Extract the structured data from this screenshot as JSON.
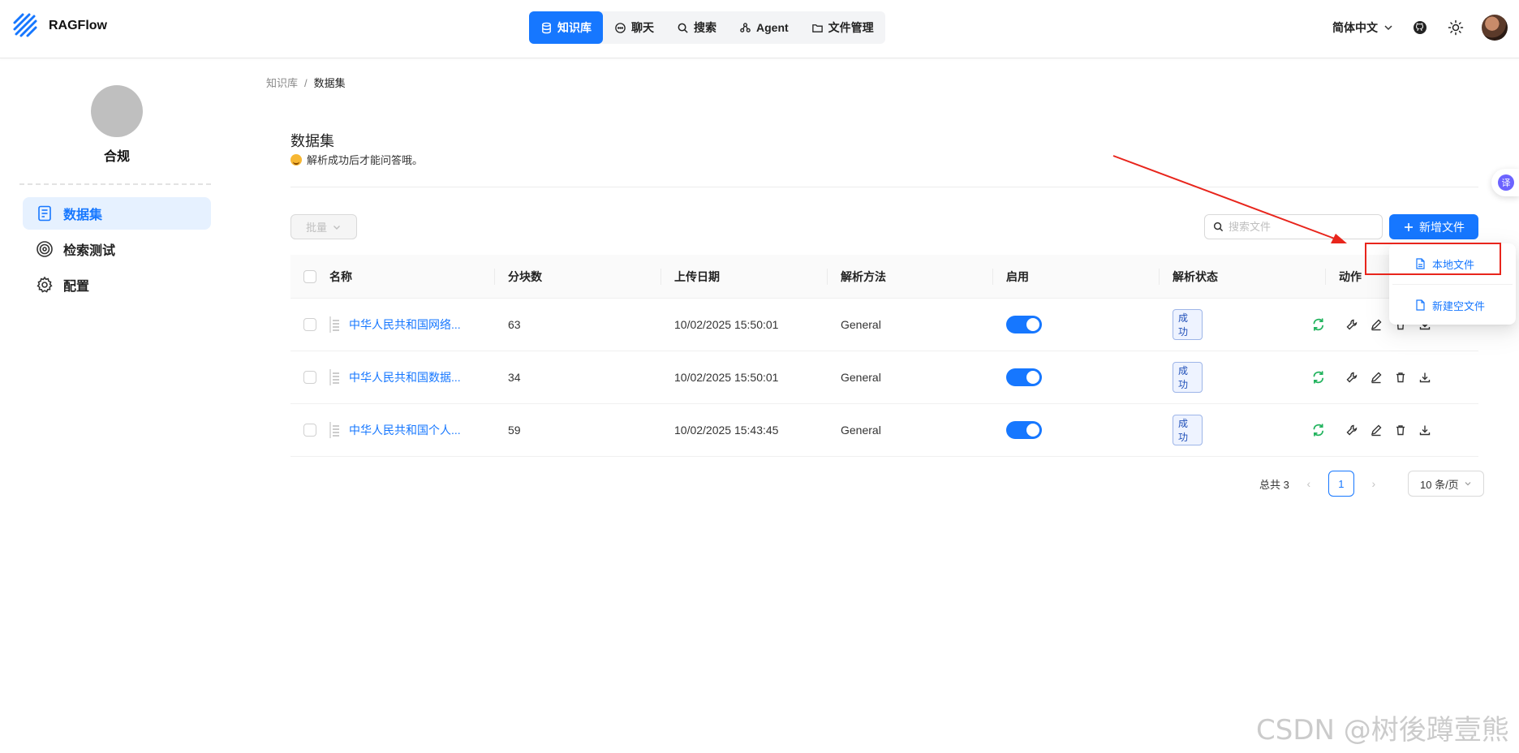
{
  "brand": {
    "name": "RAGFlow"
  },
  "nav": [
    {
      "label": "知识库",
      "icon": "database-icon"
    },
    {
      "label": "聊天",
      "icon": "chat-icon"
    },
    {
      "label": "搜索",
      "icon": "search-icon"
    },
    {
      "label": "Agent",
      "icon": "agent-icon"
    },
    {
      "label": "文件管理",
      "icon": "folder-icon"
    }
  ],
  "header": {
    "language": "简体中文"
  },
  "sidebar": {
    "kb_name": "合规",
    "items": [
      {
        "label": "数据集",
        "icon": "document-icon",
        "active": true
      },
      {
        "label": "检索测试",
        "icon": "target-icon"
      },
      {
        "label": "配置",
        "icon": "gear-icon"
      }
    ]
  },
  "breadcrumb": {
    "root": "知识库",
    "separator": "/",
    "current": "数据集"
  },
  "page": {
    "title": "数据集",
    "subtitle": "解析成功后才能问答哦。"
  },
  "toolbar": {
    "batch_label": "批量",
    "search_placeholder": "搜索文件",
    "add_label": "新增文件"
  },
  "table": {
    "columns": [
      "名称",
      "分块数",
      "上传日期",
      "解析方法",
      "启用",
      "解析状态",
      "动作"
    ],
    "rows": [
      {
        "name": "中华人民共和国网络...",
        "chunks": "63",
        "date": "10/02/2025 15:50:01",
        "method": "General",
        "enabled": true,
        "status": "成功"
      },
      {
        "name": "中华人民共和国数据...",
        "chunks": "34",
        "date": "10/02/2025 15:50:01",
        "method": "General",
        "enabled": true,
        "status": "成功"
      },
      {
        "name": "中华人民共和国个人...",
        "chunks": "59",
        "date": "10/02/2025 15:43:45",
        "method": "General",
        "enabled": true,
        "status": "成功"
      }
    ]
  },
  "pagination": {
    "total_label": "总共 3",
    "current_page": "1",
    "page_size": "10 条/页"
  },
  "dropdown": {
    "items": [
      {
        "label": "本地文件"
      },
      {
        "label": "新建空文件"
      }
    ]
  },
  "translate_badge": "译",
  "watermark": "CSDN @树後蹲壹熊",
  "colors": {
    "accent": "#1677ff",
    "annotation": "#e8251c",
    "success_refresh": "#22b35e"
  }
}
